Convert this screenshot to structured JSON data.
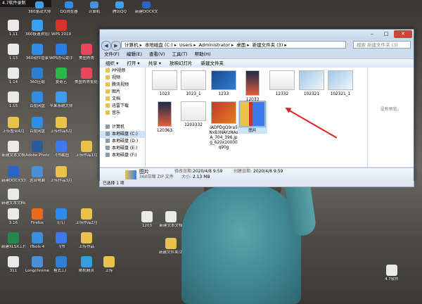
{
  "recorder_label": "4.7软件录制",
  "desktop_icons": [
    {
      "label": "1.11",
      "color": "#e9e9e9"
    },
    {
      "label": "360极速浏览器",
      "color": "#3aa0f0"
    },
    {
      "label": "WPS 2019",
      "color": "#d9342b"
    },
    {
      "label": "1.13",
      "color": "#e9e9e9"
    },
    {
      "label": "360软件管家",
      "color": "#2f8de4"
    },
    {
      "label": "WPS办公助手",
      "color": "#2a7de1"
    },
    {
      "label": "美图秀秀",
      "color": "#e9465f"
    },
    {
      "label": "1.14",
      "color": "#e9e9e9"
    },
    {
      "label": "360压缩",
      "color": "#2c7fd0"
    },
    {
      "label": "爱奇艺",
      "color": "#27b947"
    },
    {
      "label": "美图秀秀批处理",
      "color": "#e9465f"
    },
    {
      "label": "1.15",
      "color": "#e9e9e9"
    },
    {
      "label": "百度网盘",
      "color": "#2f8de4"
    },
    {
      "label": "苹果系统大师",
      "color": "#3d9df0"
    },
    {
      "label": "上传整合4月",
      "color": "#e8c24a"
    },
    {
      "label": "百度网盘",
      "color": "#2f8de4"
    },
    {
      "label": "上传作品5月",
      "color": "#e8c24a"
    },
    {
      "label": "新建文本文档",
      "color": "#e9e9e9"
    },
    {
      "label": "Adobe Photoshop CS6",
      "color": "#2b5a9e"
    },
    {
      "label": "飞书截图",
      "color": "#3d7af0"
    },
    {
      "label": "上传作品1月",
      "color": "#e8c24a"
    },
    {
      "label": "新建DOCX文档",
      "color": "#2b63c9"
    },
    {
      "label": "这台电脑",
      "color": "#4a8fd8"
    },
    {
      "label": "上传作品3月",
      "color": "#e8c24a"
    },
    {
      "label": "新建文本文档(2)",
      "color": "#e9e9e9"
    },
    {
      "label": "3.16",
      "color": "#e9e9e9"
    },
    {
      "label": "Firefox",
      "color": "#e66b1f"
    },
    {
      "label": "钉钉",
      "color": "#2a8cf0"
    },
    {
      "label": "上传作品2月",
      "color": "#e8c24a"
    },
    {
      "label": "新建文本文档",
      "color": "#e9e9e9"
    },
    {
      "label": "1203",
      "color": "#e9e9e9"
    },
    {
      "label": "新建XLSX工作表",
      "color": "#1f8a4c"
    },
    {
      "label": "iTools 4",
      "color": "#3a8ee6"
    },
    {
      "label": "飞书",
      "color": "#3d7af0"
    },
    {
      "label": "上传作品",
      "color": "#e8c24a"
    },
    {
      "label": "新建文件夹(2)",
      "color": "#e8c24a"
    },
    {
      "label": "311",
      "color": "#e9e9e9"
    },
    {
      "label": "Longchromex",
      "color": "#4a8fd8"
    },
    {
      "label": "格式工厂",
      "color": "#2f7fd6"
    },
    {
      "label": "刷机精灵",
      "color": "#2fa0e0"
    },
    {
      "label": "上传",
      "color": "#e8c24a"
    },
    {
      "label": "4.7软件",
      "color": "#e9e9e9"
    }
  ],
  "top_icons": [
    {
      "label": "360驱动大师",
      "color": "#3aa0f0"
    },
    {
      "label": "QQ浏览器",
      "color": "#2f8de4"
    },
    {
      "label": "计算机",
      "color": "#4a8fd8"
    },
    {
      "label": "腾讯QQ",
      "color": "#3aa0f0"
    },
    {
      "label": "新建DOCX文档",
      "color": "#2b63c9"
    }
  ],
  "explorer": {
    "address": [
      "计算机",
      "本地磁盘 (C:)",
      "Users",
      "Administrator",
      "桌面",
      "新建文件夹 (3)"
    ],
    "search_placeholder": "搜索 新建文件夹 (3)",
    "menu": [
      "文件(F)",
      "编辑(E)",
      "查看(V)",
      "工具(T)",
      "帮助(H)"
    ],
    "toolbar": [
      "组织 ▾",
      "打开 ▾",
      "共享 ▾",
      "放映幻灯片",
      "新建文件夹"
    ],
    "nav_items": [
      {
        "label": "PP视频",
        "type": "folder"
      },
      {
        "label": "视频",
        "type": "folder"
      },
      {
        "label": "腾讯视频",
        "type": "folder"
      },
      {
        "label": "图片",
        "type": "folder"
      },
      {
        "label": "文档",
        "type": "folder"
      },
      {
        "label": "迅雷下载",
        "type": "folder"
      },
      {
        "label": "音乐",
        "type": "folder"
      },
      {
        "label": "",
        "type": "spacer"
      },
      {
        "label": "计算机",
        "type": "drive"
      },
      {
        "label": "本地磁盘 (C:)",
        "type": "drive",
        "selected": true
      },
      {
        "label": "本地磁盘 (D:)",
        "type": "drive"
      },
      {
        "label": "本地磁盘 (E:)",
        "type": "drive"
      },
      {
        "label": "本地磁盘 (F:)",
        "type": "drive"
      }
    ],
    "files": [
      {
        "name": "1023",
        "kind": "doc"
      },
      {
        "name": "1023_1",
        "kind": "doc"
      },
      {
        "name": "1233",
        "kind": "blue"
      },
      {
        "name": "12033",
        "kind": "phone"
      },
      {
        "name": "12332",
        "kind": "doc"
      },
      {
        "name": "102321",
        "kind": "grid"
      },
      {
        "name": "102321_1",
        "kind": "grid"
      },
      {
        "name": "120363",
        "kind": "phone"
      },
      {
        "name": "1203332",
        "kind": "doc"
      },
      {
        "name": "lADPDgQ9ra5NxB3NAYzNAsA_704_396.jpg_620x10000q90g",
        "kind": "photo"
      },
      {
        "name": "图片",
        "kind": "zip",
        "selected": true
      }
    ],
    "preview_text": "没有预览。",
    "details": {
      "name": "图片",
      "type": "360压缩 ZIP 文件",
      "modified_label": "修改日期:",
      "modified": "2020/4/8 9:59",
      "size_label": "大小:",
      "size": "2.13 MB",
      "created_label": "创建日期:",
      "created": "2020/4/8 9:59"
    },
    "status": "已选择 1 项"
  }
}
